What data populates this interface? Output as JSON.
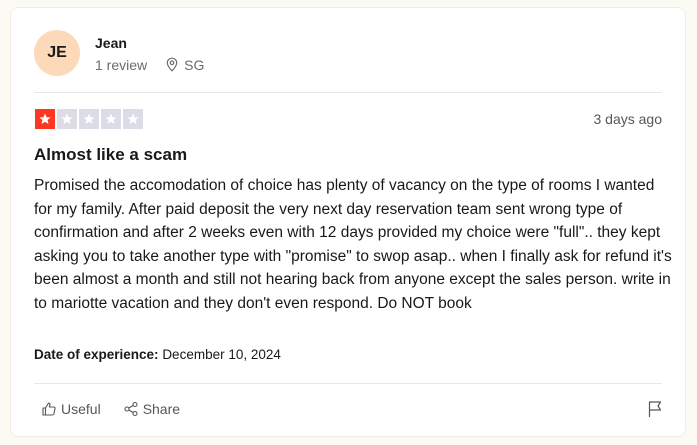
{
  "reviewer": {
    "initials": "JE",
    "name": "Jean",
    "review_count": "1 review",
    "location": "SG"
  },
  "review": {
    "rating": 1,
    "rating_max": 5,
    "posted": "3 days ago",
    "title": "Almost like a scam",
    "body": "Promised the accomodation of choice has plenty of vacancy on the type of rooms I wanted for my family. After paid deposit the very next day reservation team sent wrong type of confirmation and after 2 weeks even with 12 days provided my choice were \"full\".. they kept asking you to take another type with \"promise\" to swop asap.. when I finally ask for refund it's been almost a month and still not hearing back from anyone except the sales person. write in to mariotte vacation and they don't even respond. Do NOT book",
    "experience_label": "Date of experience:",
    "experience_date": "December 10, 2024"
  },
  "actions": {
    "useful_label": "Useful",
    "share_label": "Share"
  },
  "colors": {
    "star_filled": "#ff3722",
    "star_empty": "#dcdce6",
    "avatar_bg": "#fcd9b9"
  },
  "icons": [
    "location-pin-icon",
    "star-icon",
    "thumbs-up-icon",
    "share-icon",
    "flag-icon"
  ]
}
